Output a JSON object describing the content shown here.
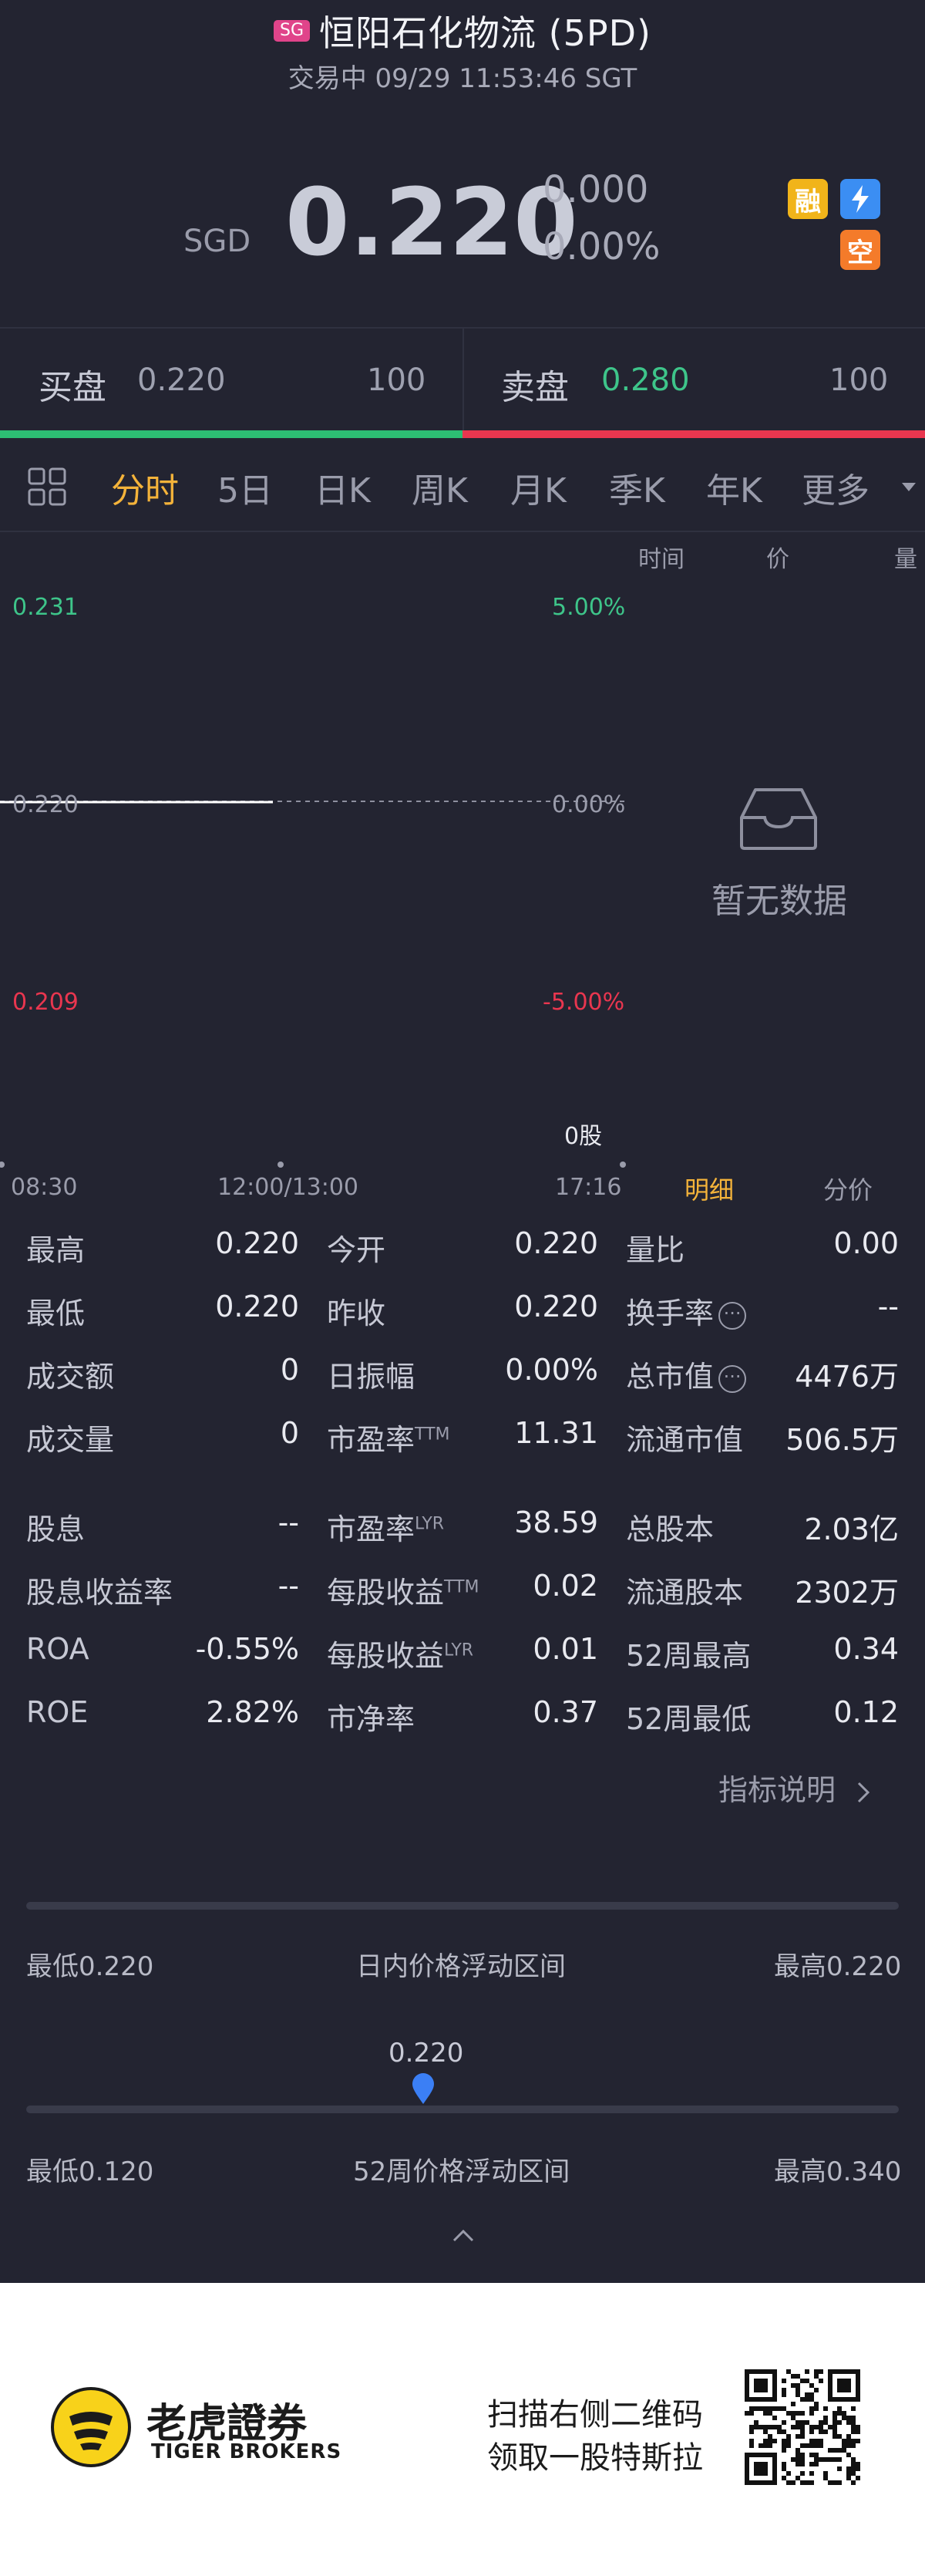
{
  "header": {
    "market_badge": "SG",
    "title": "恒阳石化物流 (5PD)",
    "status_line": "交易中 09/29 11:53:46 SGT"
  },
  "quote": {
    "currency": "SGD",
    "price": "0.220",
    "change": "0.000",
    "change_pct": "0.00%",
    "tags": [
      "融",
      "⚡",
      "空"
    ]
  },
  "orderbook": {
    "bid_label": "买盘",
    "bid_price": "0.220",
    "bid_qty": "100",
    "ask_label": "卖盘",
    "ask_price": "0.280",
    "ask_qty": "100"
  },
  "tabs": [
    "分时",
    "5日",
    "日K",
    "周K",
    "月K",
    "季K",
    "年K",
    "更多"
  ],
  "active_tab": "分时",
  "detail_columns": [
    "时间",
    "价",
    "量"
  ],
  "chart": {
    "y_high": "0.231",
    "y_mid": "0.220",
    "y_low": "0.209",
    "pct_high": "5.00%",
    "pct_mid": "0.00%",
    "pct_low": "-5.00%",
    "volume_label": "0股",
    "times": [
      "08:30",
      "12:00/13:00",
      "17:16"
    ],
    "no_data": "暂无数据",
    "sub_tabs": [
      "明细",
      "分价"
    ]
  },
  "chart_data": {
    "type": "line",
    "x": [
      "08:30",
      "12:00/13:00",
      "17:16"
    ],
    "ylim": [
      0.209,
      0.231
    ],
    "series": [
      {
        "x": [
          "08:30",
          "11:53"
        ],
        "values": [
          0.22,
          0.22
        ]
      }
    ],
    "reference_value": 0.22
  },
  "stats": [
    [
      {
        "label": "最高",
        "value": "0.220"
      },
      {
        "label": "今开",
        "value": "0.220"
      },
      {
        "label": "量比",
        "value": "0.00"
      }
    ],
    [
      {
        "label": "最低",
        "value": "0.220"
      },
      {
        "label": "昨收",
        "value": "0.220"
      },
      {
        "label": "换手率",
        "value": "--"
      }
    ],
    [
      {
        "label": "成交额",
        "value": "0"
      },
      {
        "label": "日振幅",
        "value": "0.00%"
      },
      {
        "label": "总市值",
        "value": "4476万"
      }
    ],
    [
      {
        "label": "成交量",
        "value": "0"
      },
      {
        "label": "市盈率",
        "sup": "TTM",
        "value": "11.31"
      },
      {
        "label": "流通市值",
        "value": "506.5万"
      }
    ],
    [
      {
        "label": "股息",
        "value": "--"
      },
      {
        "label": "市盈率",
        "sup": "LYR",
        "value": "38.59"
      },
      {
        "label": "总股本",
        "value": "2.03亿"
      }
    ],
    [
      {
        "label": "股息收益率",
        "value": "--"
      },
      {
        "label": "每股收益",
        "sup": "TTM",
        "value": "0.02"
      },
      {
        "label": "流通股本",
        "value": "2302万"
      }
    ],
    [
      {
        "label": "ROA",
        "value": "-0.55%"
      },
      {
        "label": "每股收益",
        "sup": "LYR",
        "value": "0.01"
      },
      {
        "label": "52周最高",
        "value": "0.34"
      }
    ],
    [
      {
        "label": "ROE",
        "value": "2.82%"
      },
      {
        "label": "市净率",
        "value": "0.37"
      },
      {
        "label": "52周最低",
        "value": "0.12"
      }
    ]
  ],
  "indicator_link": "指标说明",
  "ranges": {
    "intraday": {
      "low": "最低0.220",
      "label": "日内价格浮动区间",
      "high": "最高0.220"
    },
    "week52": {
      "low": "最低0.120",
      "label": "52周价格浮动区间",
      "high": "最高0.340"
    },
    "marker_value": "0.220",
    "marker_position": 0.455
  },
  "footer": {
    "brand_cn": "老虎證券",
    "brand_en": "TIGER BROKERS",
    "promo_line1": "扫描右侧二维码",
    "promo_line2": "领取一股特斯拉"
  },
  "colors": {
    "background": "#232431",
    "green": "#3ec58a",
    "red": "#e9364f",
    "accent": "#f4b33a",
    "marker": "#3b7ff5"
  }
}
